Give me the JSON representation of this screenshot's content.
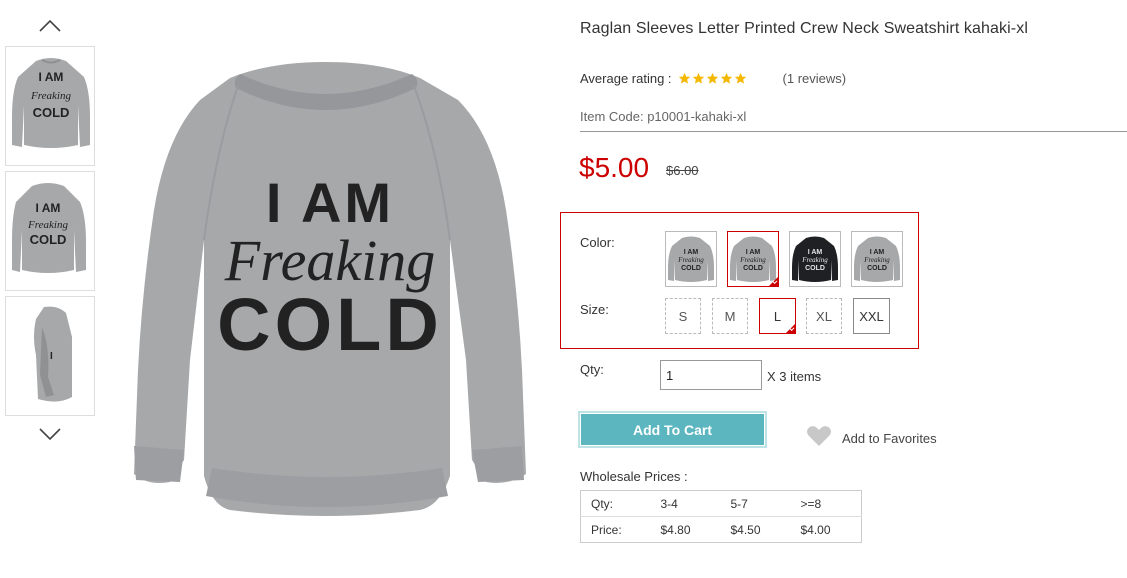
{
  "product": {
    "title": "Raglan Sleeves Letter Printed Crew Neck Sweatshirt kahaki-xl",
    "rating_label": "Average rating :",
    "rating_stars": 5,
    "reviews": "(1 reviews)",
    "item_code": "Item Code: p10001-kahaki-xl",
    "price": "$5.00",
    "old_price": "$6.00"
  },
  "main_image": {
    "lines": [
      "I AM",
      "Freaking",
      "COLD"
    ],
    "garment_color": "#a6a8aa"
  },
  "options": {
    "color_label": "Color:",
    "colors": [
      {
        "name": "gray",
        "fill": "#a6a8aa",
        "text": "#222",
        "selected": false
      },
      {
        "name": "gray",
        "fill": "#a6a8aa",
        "text": "#222",
        "selected": true
      },
      {
        "name": "black",
        "fill": "#1f2023",
        "text": "#e5e5e5",
        "selected": false
      },
      {
        "name": "gray",
        "fill": "#a6a8aa",
        "text": "#222",
        "selected": false
      }
    ],
    "size_label": "Size:",
    "sizes": [
      {
        "label": "S",
        "selected": false,
        "style": "dashed"
      },
      {
        "label": "M",
        "selected": false,
        "style": "dashed"
      },
      {
        "label": "L",
        "selected": true,
        "style": "selected"
      },
      {
        "label": "XL",
        "selected": false,
        "style": "dashed"
      },
      {
        "label": "XXL",
        "selected": false,
        "style": "solid"
      }
    ]
  },
  "qty": {
    "label": "Qty:",
    "value": "1",
    "suffix": "X 3 items"
  },
  "actions": {
    "add_to_cart": "Add To Cart",
    "favorites": "Add to Favorites"
  },
  "wholesale": {
    "label": "Wholesale Prices :",
    "rows": [
      [
        "Qty:",
        "3-4",
        "5-7",
        ">=8"
      ],
      [
        "Price:",
        "$4.80",
        "$4.50",
        "$4.00"
      ]
    ]
  },
  "colors": {
    "accent_red": "#cc0000",
    "cart_teal": "#5bb6c0",
    "star_yellow": "#f5b800"
  }
}
